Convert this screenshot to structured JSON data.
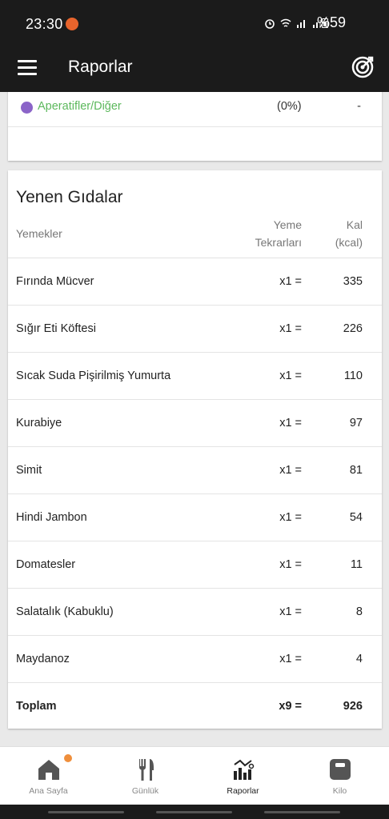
{
  "status": {
    "time": "23:30",
    "battery": "%59"
  },
  "app_bar": {
    "title": "Raporlar"
  },
  "category_row": {
    "label": "Aperatifler/Diğer",
    "percent": "(0%)",
    "value": "-",
    "dot_color": "#8b64c8",
    "label_color": "#5cb85c"
  },
  "foods": {
    "title": "Yenen Gıdalar",
    "col_food": "Yemekler",
    "col_rep_line1": "Yeme",
    "col_rep_line2": "Tekrarları",
    "col_kal_line1": "Kal",
    "col_kal_line2": "(kcal)",
    "rows": [
      {
        "name": "Fırında Mücver",
        "rep": "x1 =",
        "kcal": "335"
      },
      {
        "name": "Sığır Eti Köftesi",
        "rep": "x1 =",
        "kcal": "226"
      },
      {
        "name": "Sıcak Suda Pişirilmiş Yumurta",
        "rep": "x1 =",
        "kcal": "110"
      },
      {
        "name": "Kurabiye",
        "rep": "x1 =",
        "kcal": "97"
      },
      {
        "name": "Simit",
        "rep": "x1 =",
        "kcal": "81"
      },
      {
        "name": "Hindi Jambon",
        "rep": "x1 =",
        "kcal": "54"
      },
      {
        "name": "Domatesler",
        "rep": "x1 =",
        "kcal": "11"
      },
      {
        "name": "Salatalık (Kabuklu)",
        "rep": "x1 =",
        "kcal": "8"
      },
      {
        "name": "Maydanoz",
        "rep": "x1 =",
        "kcal": "4"
      }
    ],
    "total": {
      "name": "Toplam",
      "rep": "x9 =",
      "kcal": "926"
    }
  },
  "bottom_nav": {
    "home": "Ana Sayfa",
    "diary": "Günlük",
    "reports": "Raporlar",
    "weight": "Kilo",
    "icon_color": "#555555",
    "notif_color": "#ef8f3c"
  }
}
